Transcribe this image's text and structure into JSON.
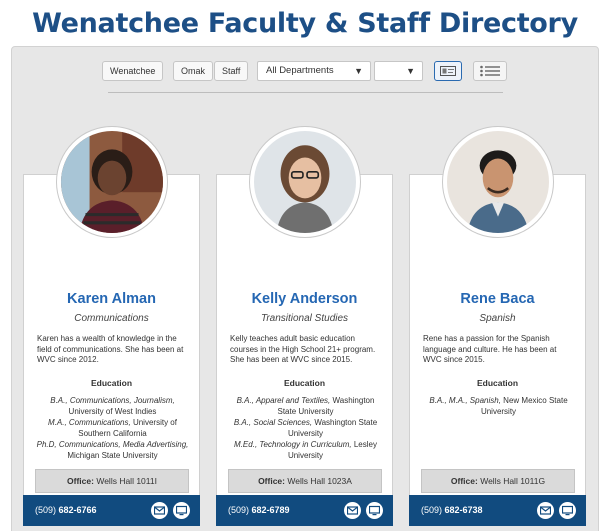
{
  "page": {
    "title": "Wenatchee Faculty & Staff Directory"
  },
  "toolbar": {
    "campus_buttons": [
      "Wenatchee",
      "Omak",
      "Staff"
    ],
    "department_select": "All Departments",
    "secondary_select": "",
    "view_card_icon": "id-card-icon",
    "view_list_icon": "list-icon"
  },
  "colors": {
    "accent": "#2567b3",
    "title": "#1d4f86",
    "footer": "#114b7f"
  },
  "labels": {
    "education": "Education",
    "office": "Office:"
  },
  "people": [
    {
      "name": "Karen Alman",
      "department": "Communications",
      "bio": "Karen has a wealth of knowledge in the field of communications. She has been at WVC since 2012.",
      "education": [
        {
          "degree": "B.A., Communications, Journalism,",
          "school": "University of West Indies"
        },
        {
          "degree": "M.A., Communications,",
          "school": "University of Southern California"
        },
        {
          "degree": "Ph.D, Communications, Media Advertising,",
          "school": "Michigan State University"
        }
      ],
      "office": "Wells Hall 1011I",
      "phone_area": "(509)",
      "phone_number": "682-6766"
    },
    {
      "name": "Kelly Anderson",
      "department": "Transitional Studies",
      "bio": "Kelly teaches adult basic education courses in the High School 21+ program. She has been at WVC since 2015.",
      "education": [
        {
          "degree": "B.A., Apparel and Textiles,",
          "school": "Washington State University"
        },
        {
          "degree": "B.A., Social Sciences,",
          "school": "Washington State University"
        },
        {
          "degree": "M.Ed., Technology in Curriculum,",
          "school": "Lesley University"
        }
      ],
      "office": "Wells Hall 1023A",
      "phone_area": "(509)",
      "phone_number": "682-6789"
    },
    {
      "name": "Rene Baca",
      "department": "Spanish",
      "bio": "Rene has a passion for the Spanish language and culture. He has been at WVC since 2015.",
      "education": [
        {
          "degree": "B.A., M.A., Spanish,",
          "school": "New Mexico State University"
        }
      ],
      "office": "Wells Hall 1011G",
      "phone_area": "(509)",
      "phone_number": "682-6738"
    }
  ]
}
